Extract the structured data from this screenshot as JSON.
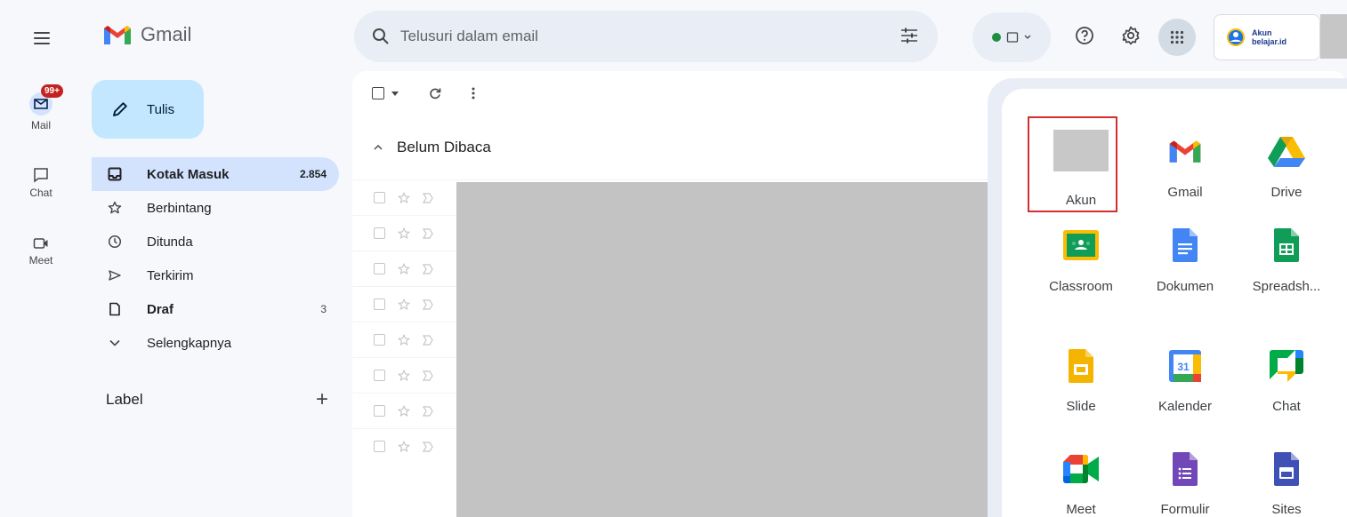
{
  "rail": {
    "mail_label": "Mail",
    "mail_badge": "99+",
    "chat_label": "Chat",
    "meet_label": "Meet"
  },
  "header": {
    "logo_text": "Gmail",
    "search_placeholder": "Telusuri dalam email",
    "account_text_line1": "Akun",
    "account_text_line2": "belajar.id"
  },
  "compose": {
    "label": "Tulis"
  },
  "nav": {
    "items": [
      {
        "label": "Kotak Masuk",
        "count": "2.854",
        "icon": "inbox-icon"
      },
      {
        "label": "Berbintang",
        "count": "",
        "icon": "star-icon"
      },
      {
        "label": "Ditunda",
        "count": "",
        "icon": "clock-icon"
      },
      {
        "label": "Terkirim",
        "count": "",
        "icon": "send-icon"
      },
      {
        "label": "Draf",
        "count": "3",
        "icon": "draft-icon"
      },
      {
        "label": "Selengkapnya",
        "count": "",
        "icon": "chevron-down-icon"
      }
    ],
    "label_header": "Label",
    "label_add": "+"
  },
  "main": {
    "section_title": "Belum Dibaca",
    "row_count": 8
  },
  "apps": {
    "items": [
      {
        "label": "Akun"
      },
      {
        "label": "Gmail"
      },
      {
        "label": "Drive"
      },
      {
        "label": "Classroom"
      },
      {
        "label": "Dokumen"
      },
      {
        "label": "Spreadsh..."
      },
      {
        "label": "Slide"
      },
      {
        "label": "Kalender"
      },
      {
        "label": "Chat"
      },
      {
        "label": "Meet"
      },
      {
        "label": "Formulir"
      },
      {
        "label": "Sites"
      }
    ],
    "calendar_day": "31"
  },
  "colors": {
    "accent_blue": "#0b57d0",
    "active_nav": "#d3e3fd",
    "compose_bg": "#c2e7ff",
    "highlight_red": "#d32f2f",
    "status_green": "#1e8e3e"
  }
}
